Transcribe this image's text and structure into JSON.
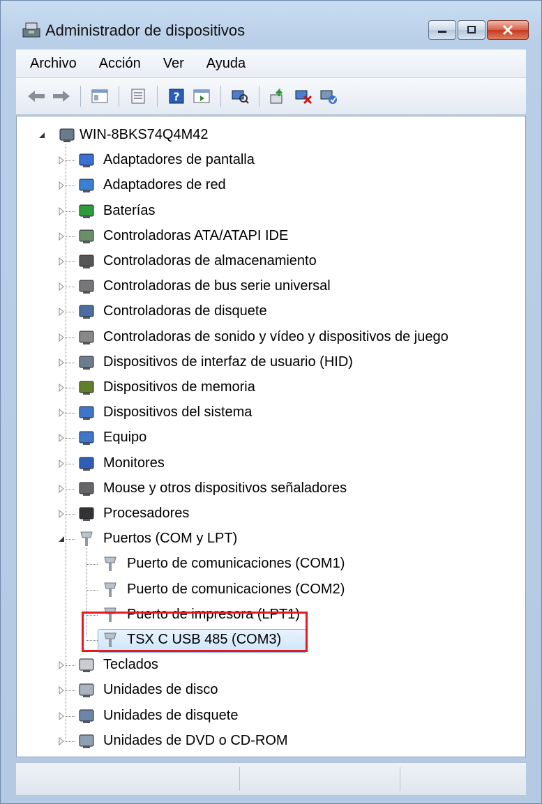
{
  "window": {
    "title": "Administrador de dispositivos"
  },
  "menu": [
    "Archivo",
    "Acción",
    "Ver",
    "Ayuda"
  ],
  "toolbar": [
    "back-icon",
    "forward-icon",
    "show-hide-tree-icon",
    "properties-icon",
    "help-icon",
    "action-pane-icon",
    "scan-hardware-icon",
    "update-driver-icon",
    "uninstall-icon",
    "enable-device-icon"
  ],
  "tree": {
    "root": "WIN-8BKS74Q4M42",
    "categories": [
      "Adaptadores de pantalla",
      "Adaptadores de red",
      "Baterías",
      "Controladoras ATA/ATAPI IDE",
      "Controladoras de almacenamiento",
      "Controladoras de bus serie universal",
      "Controladoras de disquete",
      "Controladoras de sonido y vídeo y dispositivos de juego",
      "Dispositivos de interfaz de usuario (HID)",
      "Dispositivos de memoria",
      "Dispositivos del sistema",
      "Equipo",
      "Monitores",
      "Mouse y otros dispositivos señaladores",
      "Procesadores",
      "Puertos (COM y LPT)"
    ],
    "ports": [
      "Puerto de comunicaciones (COM1)",
      "Puerto de comunicaciones (COM2)",
      "Puerto de impresora (LPT1)",
      "TSX C USB 485 (COM3)"
    ],
    "after": [
      "Teclados",
      "Unidades de disco",
      "Unidades de disquete",
      "Unidades de DVD o CD-ROM"
    ]
  },
  "colors": {
    "highlight_border": "#e01b24",
    "selection": "#cfe5fa"
  }
}
